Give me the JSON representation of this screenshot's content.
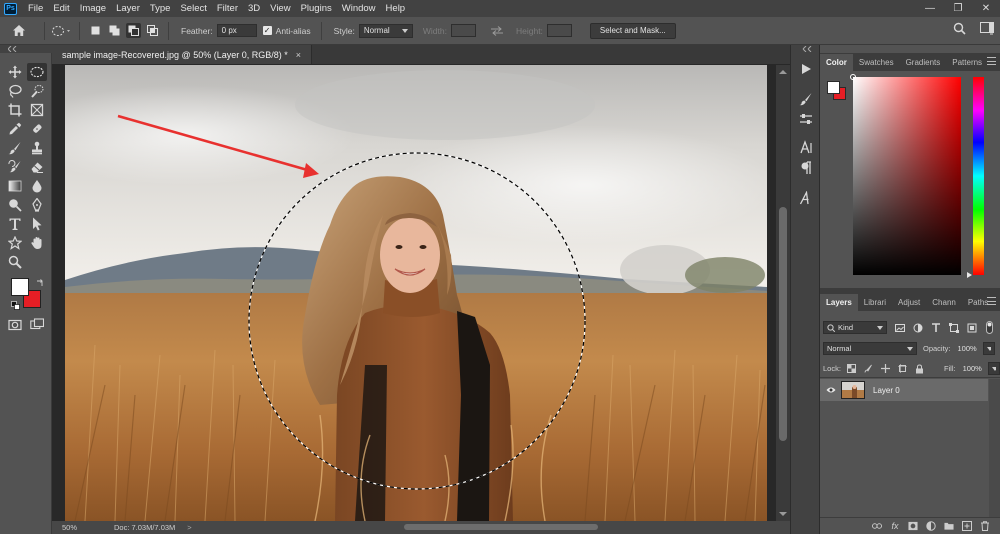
{
  "app": {
    "logo": "Ps"
  },
  "menu": [
    "File",
    "Edit",
    "Image",
    "Layer",
    "Type",
    "Select",
    "Filter",
    "3D",
    "View",
    "Plugins",
    "Window",
    "Help"
  ],
  "window_controls": {
    "minimize": "—",
    "restore": "❐",
    "close": "✕"
  },
  "options": {
    "feather_label": "Feather:",
    "feather_value": "0 px",
    "antialias_label": "Anti-alias",
    "antialias_checked": true,
    "style_label": "Style:",
    "style_value": "Normal",
    "width_label": "Width:",
    "height_label": "Height:",
    "select_mask_label": "Select and Mask..."
  },
  "document": {
    "tab_title": "sample image-Recovered.jpg @ 50% (Layer 0, RGB/8) *",
    "close_glyph": "×"
  },
  "status": {
    "zoom": "50%",
    "doc_info": "Doc: 7.03M/7.03M",
    "arrow": ">"
  },
  "color_panel": {
    "tabs": [
      "Color",
      "Swatches",
      "Gradients",
      "Patterns"
    ],
    "active_tab": "Color",
    "foreground": "#ffffff",
    "background": "#e61e25"
  },
  "layers_panel": {
    "tabs": [
      "Layers",
      "Librari",
      "Adjust",
      "Chann",
      "Paths"
    ],
    "active_tab": "Layers",
    "kind_label": "Kind",
    "blend_mode": "Normal",
    "opacity_label": "Opacity:",
    "opacity_value": "100%",
    "lock_label": "Lock:",
    "fill_label": "Fill:",
    "fill_value": "100%",
    "layers": [
      {
        "name": "Layer 0",
        "visible": true
      }
    ]
  },
  "annotation": {
    "arrow_color": "#e8312f"
  }
}
